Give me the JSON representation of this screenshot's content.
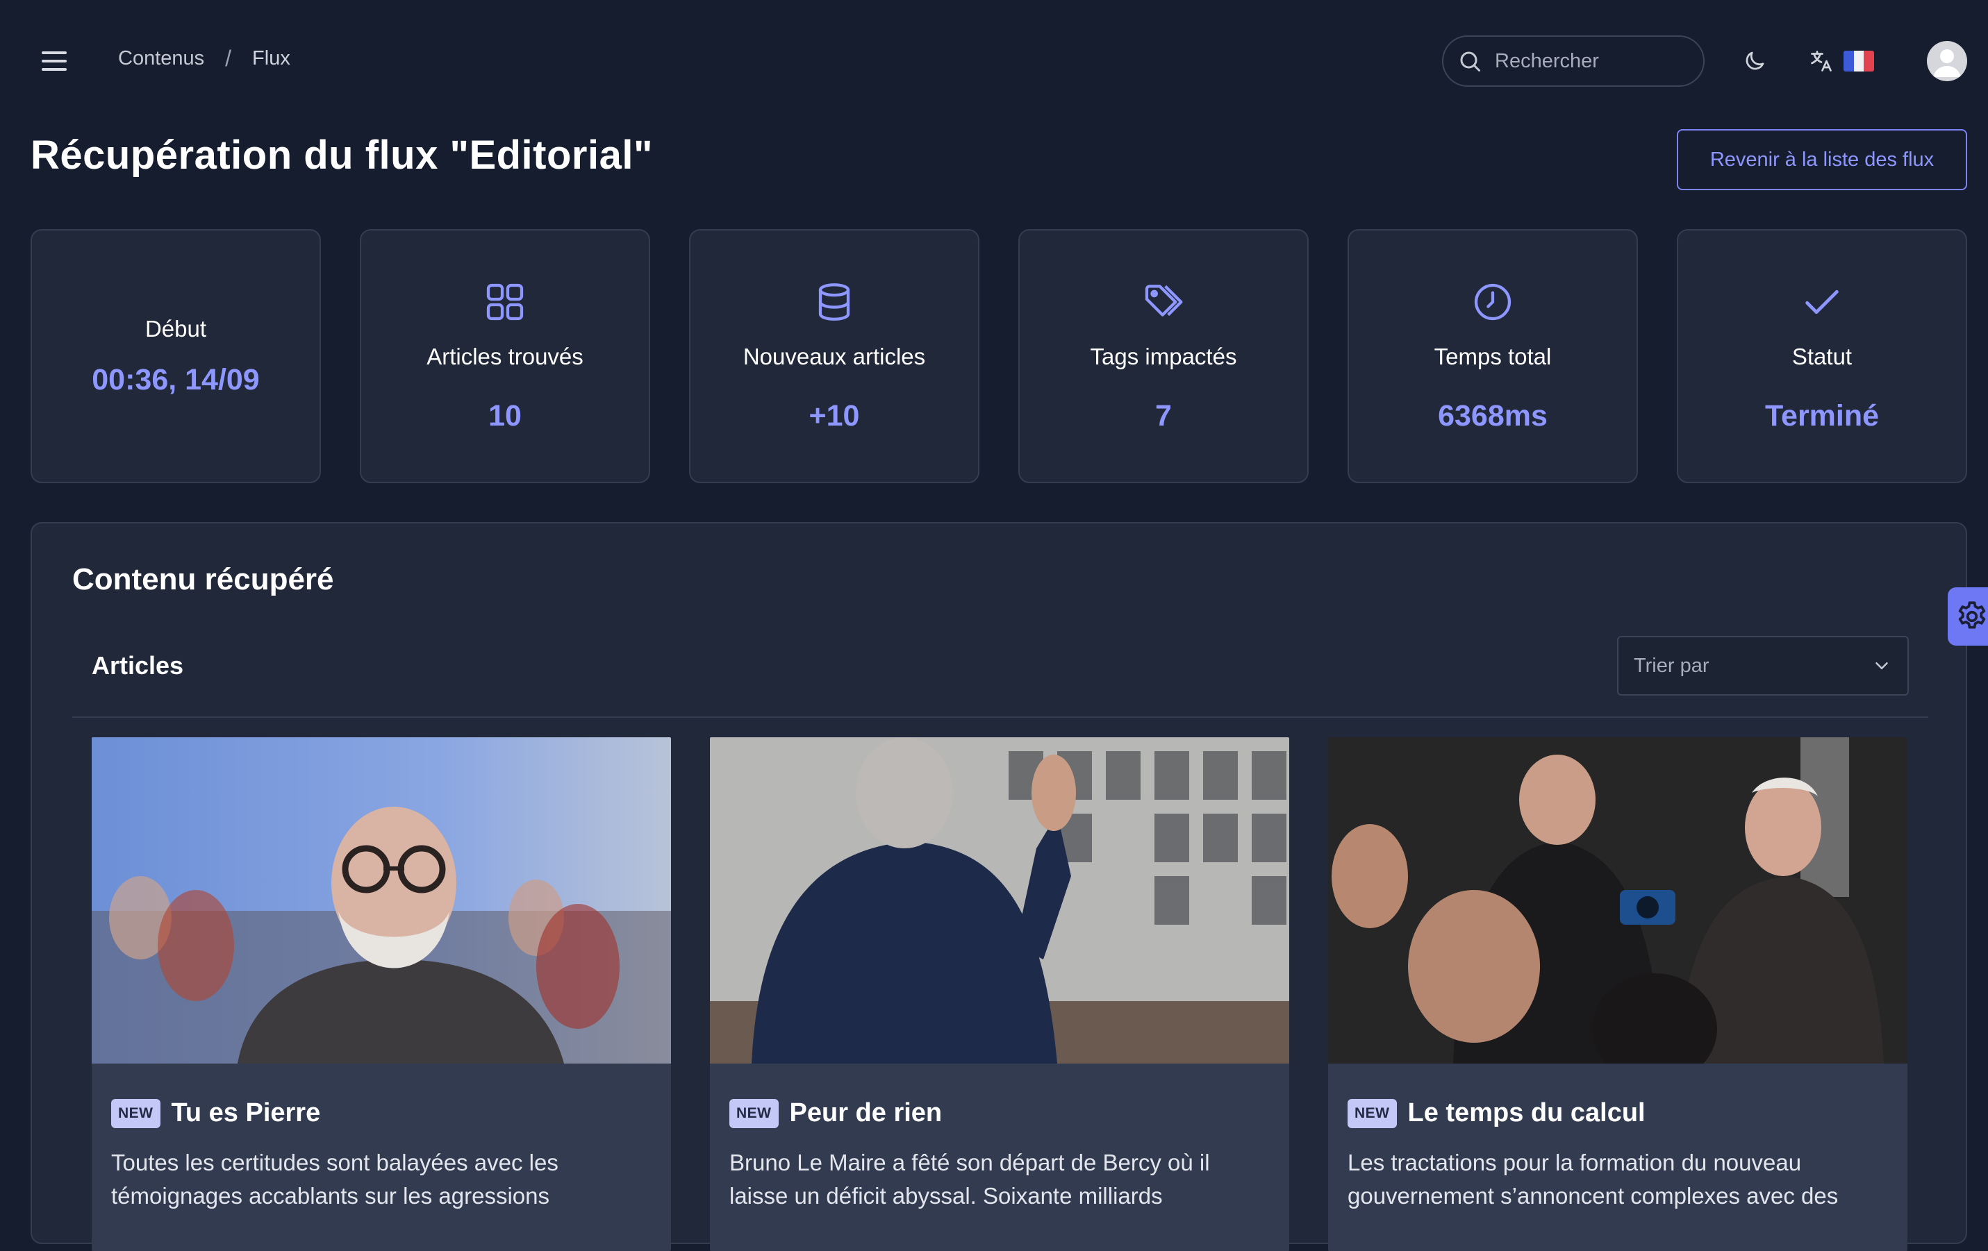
{
  "breadcrumb": {
    "parent": "Contenus",
    "separator": "/",
    "current": "Flux"
  },
  "search": {
    "placeholder": "Rechercher"
  },
  "page": {
    "title": "Récupération du flux \"Editorial\"",
    "back_button": "Revenir à la liste des flux"
  },
  "stats": [
    {
      "label": "Début",
      "value": "00:36, 14/09",
      "icon": "none"
    },
    {
      "label": "Articles trouvés",
      "value": "10",
      "icon": "grid-icon"
    },
    {
      "label": "Nouveaux articles",
      "value": "+10",
      "icon": "database-icon"
    },
    {
      "label": "Tags impactés",
      "value": "7",
      "icon": "tags-icon"
    },
    {
      "label": "Temps total",
      "value": "6368ms",
      "icon": "clock-icon"
    },
    {
      "label": "Statut",
      "value": "Terminé",
      "icon": "check-icon"
    }
  ],
  "content": {
    "title": "Contenu récupéré",
    "articles_title": "Articles",
    "sort_placeholder": "Trier par"
  },
  "articles": [
    {
      "badge": "NEW",
      "title": "Tu es Pierre",
      "description": "Toutes les certitudes sont balayées avec les témoignages accablants sur les agressions",
      "image": "photo of an elderly bearded man with glasses in a dark coat"
    },
    {
      "badge": "NEW",
      "title": "Peur de rien",
      "description": "Bruno Le Maire a fêté son départ de Bercy où il laisse un déficit abyssal. Soixante milliards",
      "image": "photo of a man in a suit waving to a crowd, seen from behind"
    },
    {
      "badge": "NEW",
      "title": "Le temps du calcul",
      "description": "Les tractations pour la formation du nouveau gouvernement s’annoncent complexes avec des",
      "image": "photo of men in suits greeting each other among photographers"
    }
  ],
  "colors": {
    "background": "#161d2e",
    "card": "#202839",
    "accent": "#8e97ff",
    "article_card": "#323b50",
    "badge": "#c3c8f7",
    "settings_tab": "#6e78f5"
  }
}
